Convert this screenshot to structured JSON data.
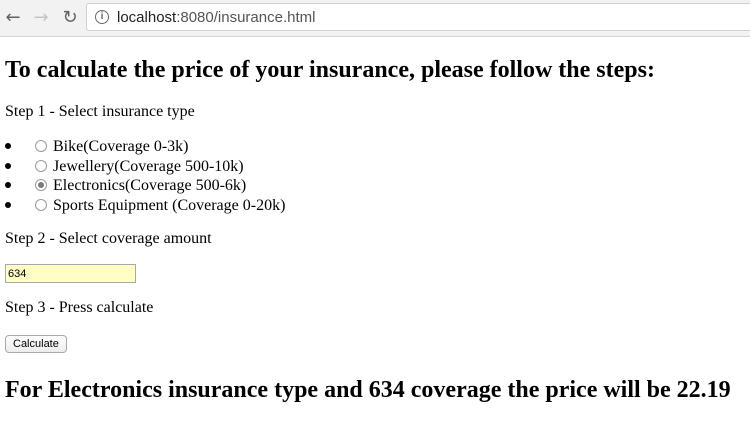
{
  "browser": {
    "back_glyph": "←",
    "forward_glyph": "→",
    "reload_glyph": "↻",
    "url_host": "localhost",
    "url_rest": ":8080/insurance.html"
  },
  "page": {
    "heading": "To calculate the price of your insurance, please follow the steps:",
    "step1": "Step 1 - Select insurance type",
    "options": [
      {
        "label": "Bike(Coverage 0-3k)",
        "checked": false
      },
      {
        "label": "Jewellery(Coverage 500-10k)",
        "checked": false
      },
      {
        "label": "Electronics(Coverage 500-6k)",
        "checked": true
      },
      {
        "label": "Sports Equipment (Coverage 0-20k)",
        "checked": false
      }
    ],
    "step2": "Step 2 - Select coverage amount",
    "coverage_value": "634",
    "step3": "Step 3 - Press calculate",
    "calculate_label": "Calculate",
    "result": "For Electronics insurance type and 634 coverage the price will be 22.19"
  },
  "colors": {
    "input_background": "#ffffc5"
  }
}
